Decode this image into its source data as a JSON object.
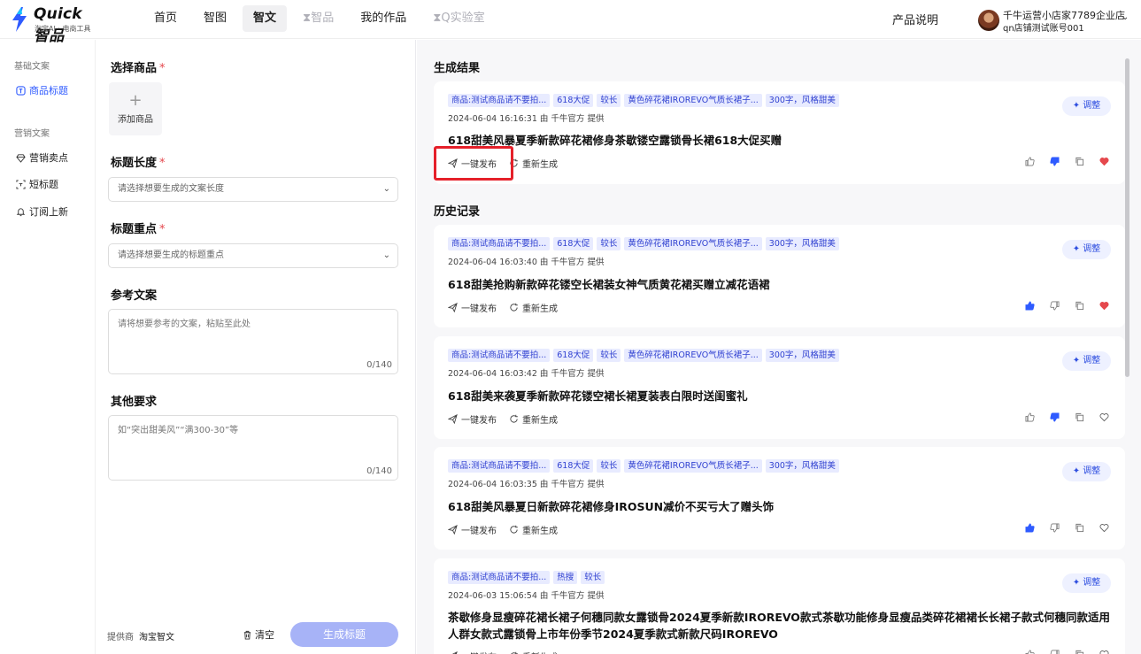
{
  "app": {
    "logo_title": "Quick 智品",
    "logo_subtitle": "淘宝AI · 电商工具",
    "nav": [
      {
        "label": "首页",
        "state": "normal"
      },
      {
        "label": "智图",
        "state": "normal"
      },
      {
        "label": "智文",
        "state": "active"
      },
      {
        "label": "智品",
        "state": "disabled"
      },
      {
        "label": "我的作品",
        "state": "normal"
      },
      {
        "label": "Q实验室",
        "state": "disabled"
      }
    ],
    "product_desc": "产品说明",
    "user_name": "千牛运营小店家7789企业店",
    "user_account": "qn店铺测试账号001"
  },
  "sidebar": {
    "group1": "基础文案",
    "item_title": "商品标题",
    "group2": "营销文案",
    "item_selling": "营销卖点",
    "item_short": "短标题",
    "item_subscribe": "订阅上新"
  },
  "form": {
    "select_product_label": "选择商品",
    "add_product": "添加商品",
    "length_label": "标题长度",
    "length_placeholder": "请选择想要生成的文案长度",
    "focus_label": "标题重点",
    "focus_placeholder": "请选择想要生成的标题重点",
    "ref_label": "参考文案",
    "ref_placeholder": "请将想要参考的文案，粘贴至此处",
    "ref_count": "0/140",
    "other_label": "其他要求",
    "other_placeholder": "如“突出甜美风”“满300-30”等",
    "other_count": "0/140",
    "provider_label": "提供商",
    "provider_value": "淘宝智文",
    "clear": "清空",
    "generate": "生成标题"
  },
  "results": {
    "generated_title": "生成结果",
    "history_title": "历史记录",
    "adjust": "调整",
    "publish": "一键发布",
    "regenerate": "重新生成",
    "cards": [
      {
        "tags": [
          "商品:测试商品请不要拍...",
          "618大促",
          "较长",
          "黄色碎花裙IROREVO气质长裙子...",
          "300字，风格甜美"
        ],
        "meta": "2024-06-04 16:16:31 由 千牛官方 提供",
        "title": "618甜美风暴夏季新款碎花裙修身茶歇镂空露锁骨长裙618大促买赠",
        "like": false,
        "dislike": true,
        "fav": true
      },
      {
        "tags": [
          "商品:测试商品请不要拍...",
          "618大促",
          "较长",
          "黄色碎花裙IROREVO气质长裙子...",
          "300字，风格甜美"
        ],
        "meta": "2024-06-04 16:03:40 由 千牛官方 提供",
        "title": "618甜美抢购新款碎花镂空长裙装女神气质黄花裙买赠立减花语裙",
        "like": true,
        "dislike": false,
        "fav": true
      },
      {
        "tags": [
          "商品:测试商品请不要拍...",
          "618大促",
          "较长",
          "黄色碎花裙IROREVO气质长裙子...",
          "300字，风格甜美"
        ],
        "meta": "2024-06-04 16:03:42 由 千牛官方 提供",
        "title": "618甜美来袭夏季新款碎花镂空裙长裙夏装表白限时送闺蜜礼",
        "like": false,
        "dislike": true,
        "fav": false
      },
      {
        "tags": [
          "商品:测试商品请不要拍...",
          "618大促",
          "较长",
          "黄色碎花裙IROREVO气质长裙子...",
          "300字，风格甜美"
        ],
        "meta": "2024-06-04 16:03:35 由 千牛官方 提供",
        "title": "618甜美风暴夏日新款碎花裙修身IROSUN减价不买亏大了赠头饰",
        "like": true,
        "dislike": false,
        "fav": false
      },
      {
        "tags": [
          "商品:测试商品请不要拍...",
          "热搜",
          "较长"
        ],
        "meta": "2024-06-03 15:06:54 由 千牛官方 提供",
        "title": "茶歇修身显瘦碎花裙长裙子何穗同款女露锁骨2024夏季新款IROREVO款式茶歇功能修身显瘦品类碎花裙裙长长裙子款式何穗同款适用人群女款式露锁骨上市年份季节2024夏季款式新款尺码IROREVO",
        "like": false,
        "dislike": false,
        "fav": false
      }
    ]
  },
  "colors": {
    "accent": "#2f5bff",
    "tag_bg": "#e8ebff",
    "tag_text": "#3142d1",
    "heart": "#e5484d",
    "highlight_box": "#e5202a"
  }
}
